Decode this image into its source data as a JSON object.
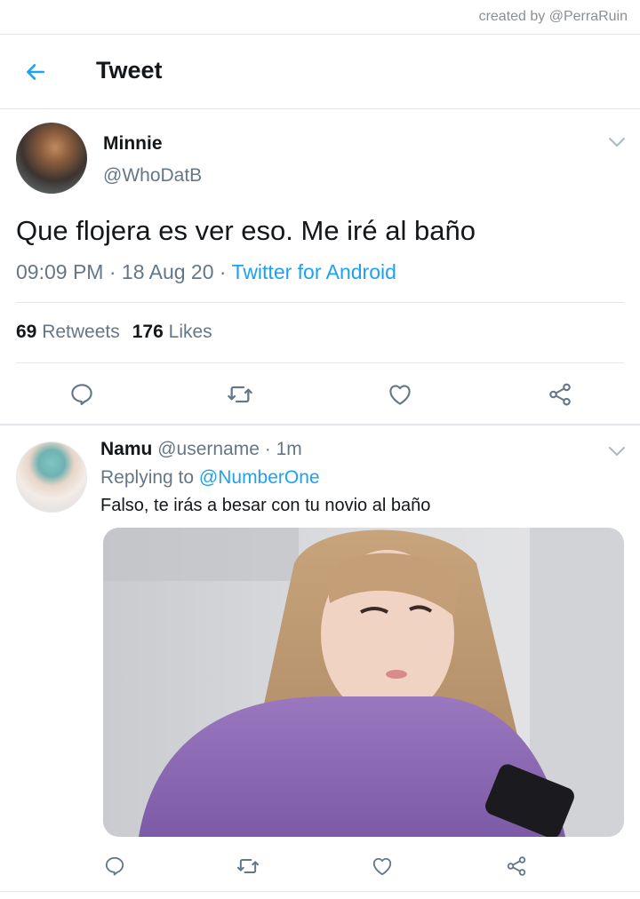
{
  "credit": "created by @PerraRuin",
  "header": {
    "title": "Tweet"
  },
  "tweet": {
    "author_name": "Minnie",
    "author_handle": "@WhoDatB",
    "text": "Que flojera es ver eso. Me iré al baño",
    "time": "09:09 PM",
    "date": "18 Aug 20",
    "source": "Twitter for Android",
    "retweets_count": "69",
    "retweets_label": "Retweets",
    "likes_count": "176",
    "likes_label": "Likes"
  },
  "reply": {
    "author_name": "Namu",
    "author_handle": "@username",
    "time": "1m",
    "replying_label": "Replying to",
    "replying_to": "@NumberOne",
    "text": "Falso, te irás a besar con tu novio al baño"
  },
  "colors": {
    "accent": "#1da1f2",
    "secondary_text": "#657786",
    "divider": "#e1e6ea"
  },
  "icons": [
    "back-arrow-icon",
    "chevron-down-icon",
    "reply-icon",
    "retweet-icon",
    "like-icon",
    "share-icon"
  ]
}
